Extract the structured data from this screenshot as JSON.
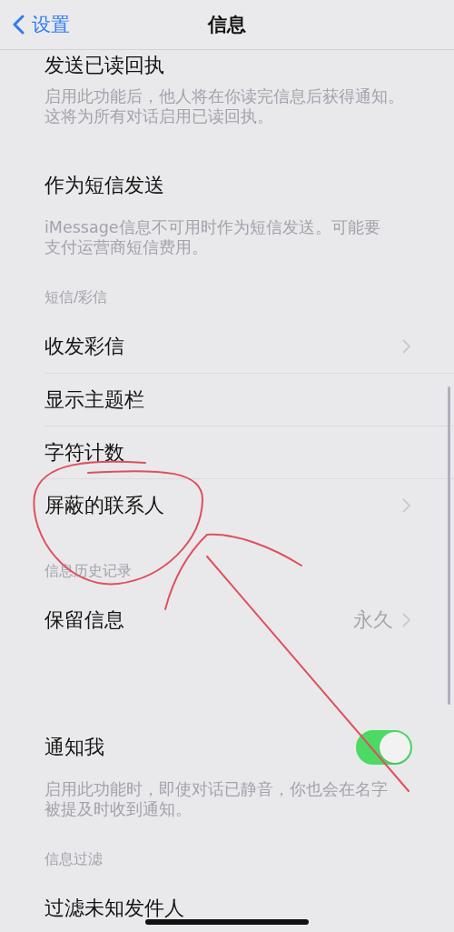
{
  "nav": {
    "back_label": "设置",
    "title": "信息"
  },
  "sections": [
    {
      "rows": [
        {
          "kind": "plain",
          "label": "发送已读回执"
        }
      ],
      "footnote": [
        "启用此功能后，他人将在你读完信息后获得通知。",
        "这将为所有对话启用已读回执。"
      ]
    },
    {
      "rows": [
        {
          "kind": "plain",
          "label": "作为短信发送"
        }
      ],
      "footnote": [
        "iMessage信息不可用时作为短信发送。可能要",
        "支付运营商短信费用。"
      ]
    },
    {
      "header": "短信/彩信",
      "rows": [
        {
          "kind": "link",
          "label": "收发彩信"
        },
        {
          "kind": "plain",
          "label": "显示主题栏"
        },
        {
          "kind": "plain",
          "label": "字符计数"
        },
        {
          "kind": "link",
          "label": "屏蔽的联系人"
        }
      ]
    },
    {
      "header": "信息历史记录",
      "rows": [
        {
          "kind": "value",
          "label": "保留信息",
          "value": "永久"
        }
      ]
    },
    {
      "rows": [
        {
          "kind": "toggle",
          "label": "通知我",
          "on": true
        }
      ],
      "footnote": [
        "启用此功能时，即使对话已静音，你也会在名字",
        "被提及时收到通知。"
      ]
    },
    {
      "header": "信息过滤",
      "rows": [
        {
          "kind": "plain",
          "label": "过滤未知发件人"
        }
      ]
    }
  ]
}
